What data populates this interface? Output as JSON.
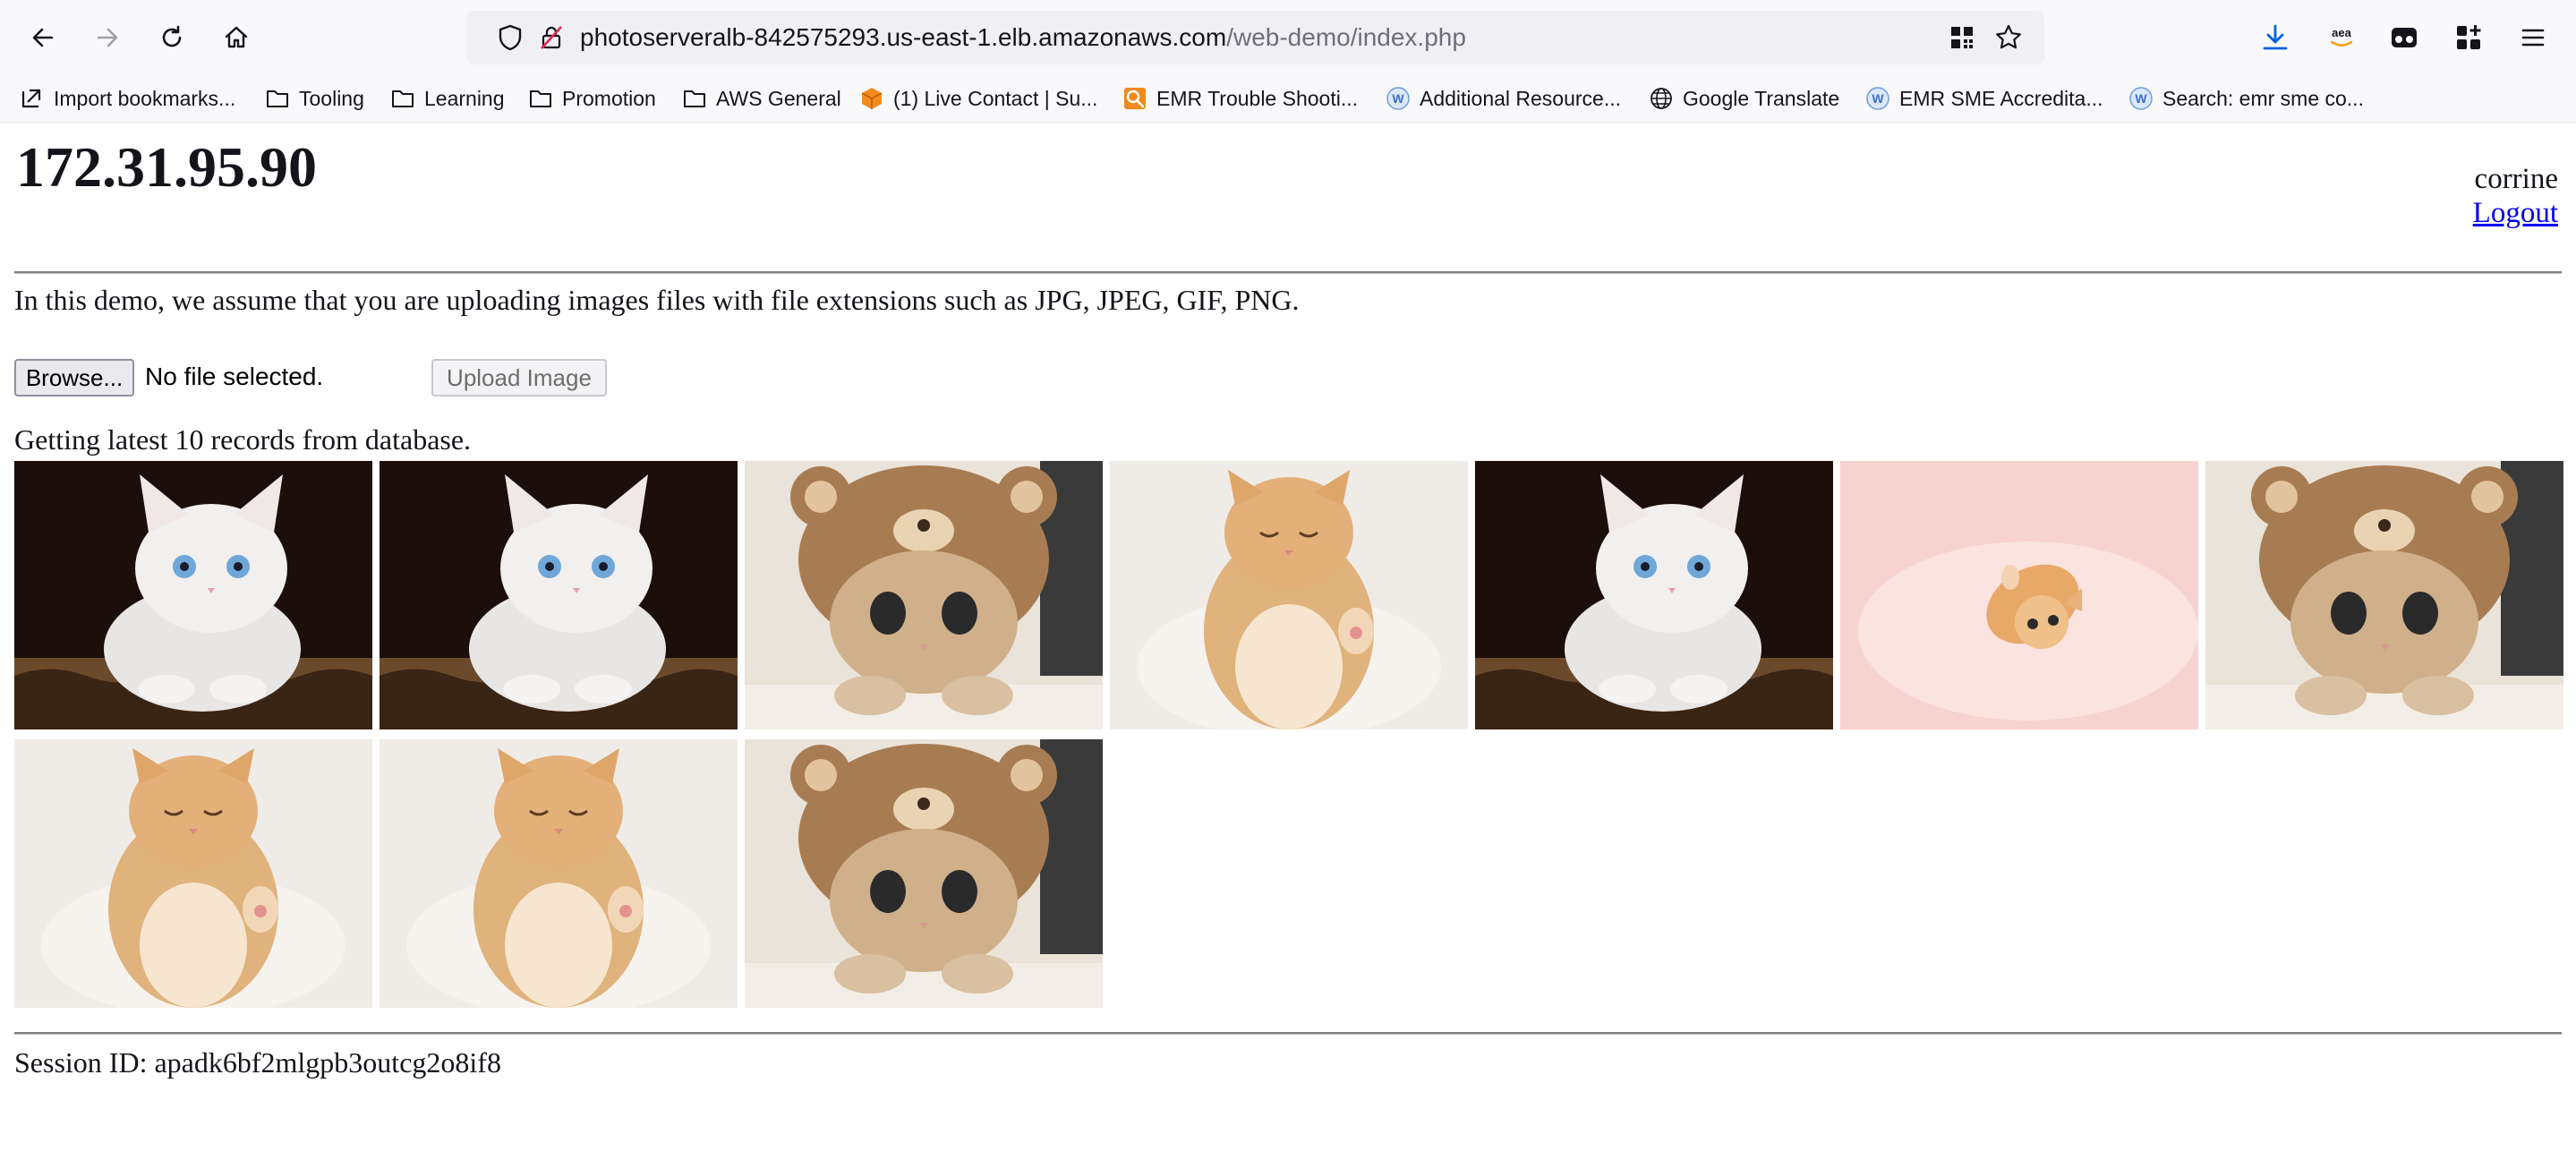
{
  "browser": {
    "url_host": "photoserveralb-842575293.us-east-1.elb.amazonaws.com",
    "url_path": "/web-demo/index.php",
    "toolbar_icons": [
      "back-arrow-icon",
      "forward-arrow-icon",
      "reload-icon",
      "home-icon",
      "shield-icon",
      "insecure-lock-icon",
      "qr-code-icon",
      "star-icon",
      "download-icon",
      "amazon-extension-icon",
      "reader-icon",
      "extensions-icon",
      "menu-icon"
    ],
    "amazon_icon_text": "aea",
    "bookmarks": [
      {
        "label": "Import bookmarks...",
        "icon": "import-icon"
      },
      {
        "label": "Tooling",
        "icon": "folder-icon"
      },
      {
        "label": "Learning",
        "icon": "folder-icon"
      },
      {
        "label": "Promotion",
        "icon": "folder-icon"
      },
      {
        "label": "AWS General",
        "icon": "folder-icon"
      },
      {
        "label": "(1) Live Contact | Su...",
        "icon": "cube-icon"
      },
      {
        "label": "EMR Trouble Shooti...",
        "icon": "search-doc-icon"
      },
      {
        "label": "Additional Resource...",
        "icon": "w-icon"
      },
      {
        "label": "Google Translate",
        "icon": "globe-icon"
      },
      {
        "label": "EMR SME Accredita...",
        "icon": "w-icon"
      },
      {
        "label": "Search: emr sme co...",
        "icon": "w-icon"
      }
    ],
    "w_icon_letter": "W"
  },
  "page": {
    "ip_heading": "172.31.95.90",
    "username": "corrine",
    "logout_label": "Logout",
    "intro_text": "In this demo, we assume that you are uploading images files with file extensions such as JPG, JPEG, GIF, PNG.",
    "browse_label": "Browse...",
    "no_file_text": "No file selected.",
    "upload_label": "Upload Image",
    "records_text": "Getting latest 10 records from database.",
    "images": [
      {
        "subject": "white kitten with blue eyes"
      },
      {
        "subject": "white kitten with blue eyes"
      },
      {
        "subject": "kitten in bear hat"
      },
      {
        "subject": "orange kitten sleeping on fur"
      },
      {
        "subject": "white kitten with blue eyes"
      },
      {
        "subject": "orange kitten on pink blanket"
      },
      {
        "subject": "kitten in bear hat"
      },
      {
        "subject": "orange kitten sleeping on fur"
      },
      {
        "subject": "orange kitten sleeping on fur"
      },
      {
        "subject": "kitten in bear hat"
      }
    ],
    "session_text": "Session ID: apadk6bf2mlgpb3outcg2o8if8"
  },
  "colors": {
    "link": "#0000ee",
    "toolbar_bg": "#f9f9fb",
    "urlbar_bg": "#f0f0f4",
    "download_blue": "#0061e0"
  }
}
